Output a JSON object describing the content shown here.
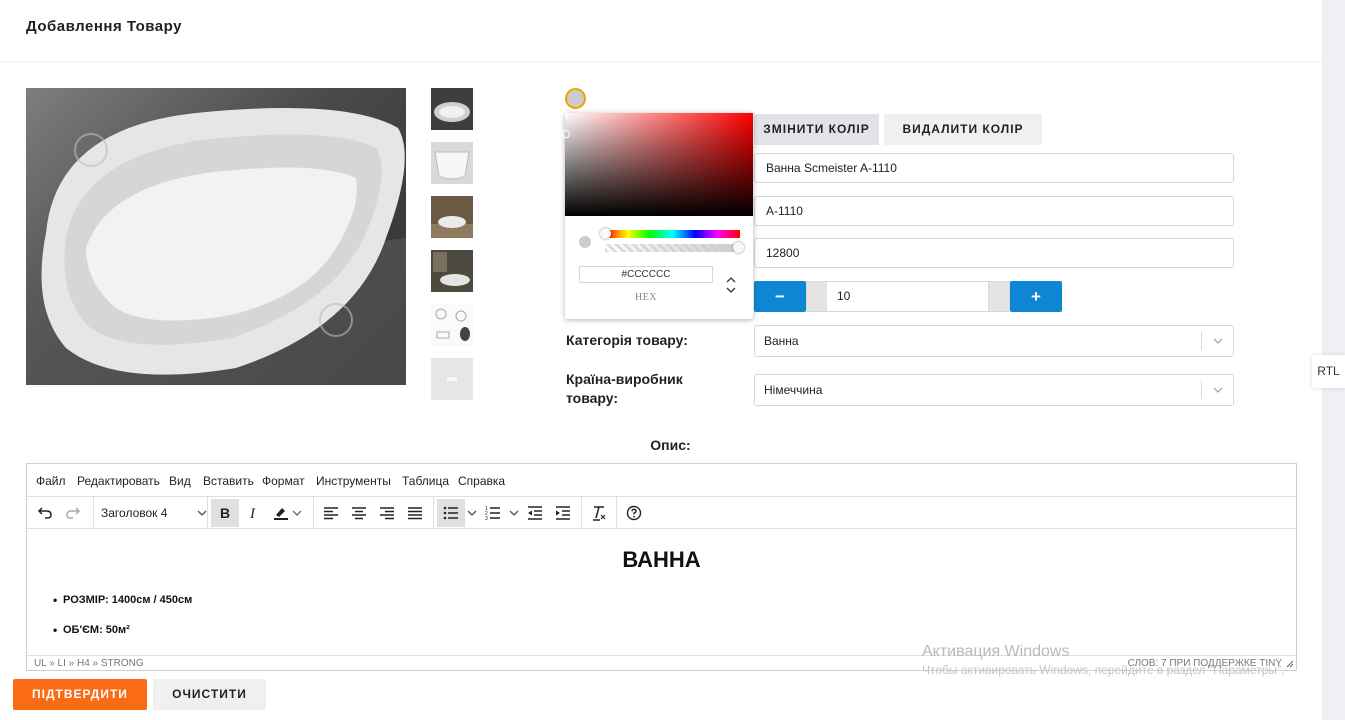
{
  "page": {
    "title": "Добавлення Товару"
  },
  "color": {
    "current_hex": "#cccccc",
    "change_label": "ЗМІНИТИ КОЛІР",
    "remove_label": "ВИДАЛИТИ КОЛІР",
    "picker": {
      "hex_value": "#CCCCCC",
      "mode_label": "HEX"
    }
  },
  "form": {
    "name_value": "Ванна Scmeister A-1110",
    "sku_value": "A-1110",
    "price_value": "12800",
    "quantity": {
      "value": "10",
      "minus_label": "−",
      "plus_label": "+"
    },
    "category": {
      "label": "Категорія товару:",
      "value": "Ванна"
    },
    "country": {
      "label": "Країна-виробник товару:",
      "value": "Німеччина"
    }
  },
  "description": {
    "label": "Опис:",
    "menu": [
      "Файл",
      "Редактировать",
      "Вид",
      "Вставить",
      "Формат",
      "Инструменты",
      "Таблица",
      "Справка"
    ],
    "block_format": "Заголовок 4",
    "heading": "ВАННА",
    "bullets": [
      "РОЗМІР: 1400см / 450см",
      "ОБ'ЄМ: 50м²"
    ],
    "path": "UL » LI » H4 » STRONG",
    "word_count": "СЛОВ: 7  ПРИ ПОДДЕРЖКЕ TINY"
  },
  "actions": {
    "submit_label": "ПІДТВЕРДИТИ",
    "clear_label": "ОЧИСТИТИ"
  },
  "sidebar_tab": {
    "label": "RTL"
  },
  "watermark": {
    "line1": "Активация Windows",
    "line2": "Чтобы активировать Windows, перейдите в раздел \"Параметры\"."
  }
}
